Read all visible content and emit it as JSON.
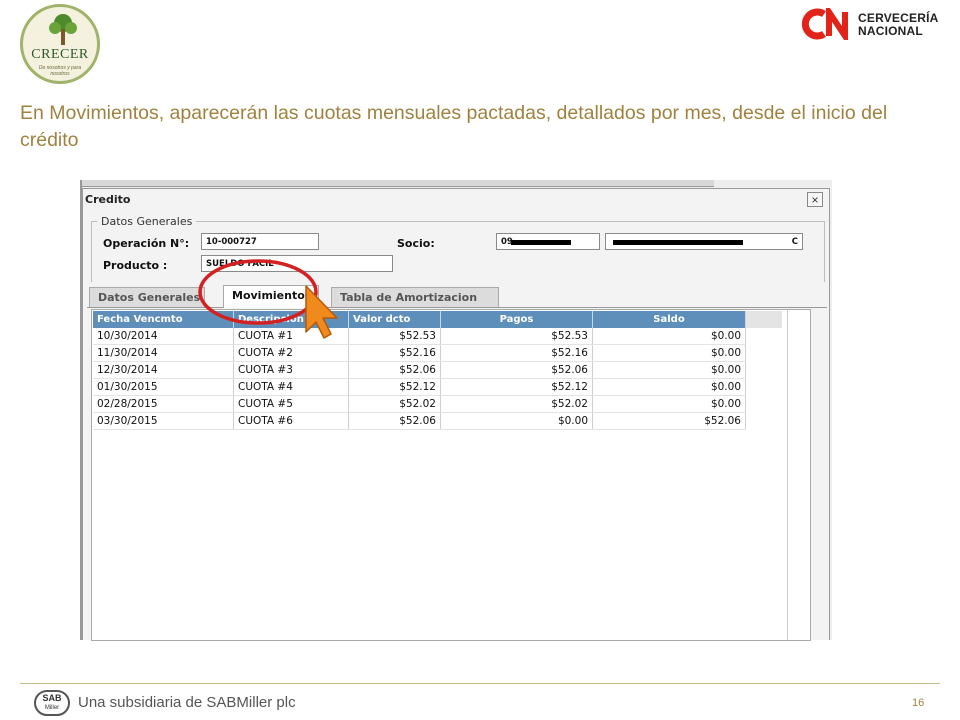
{
  "header": {
    "left_logo": {
      "name": "CRECER",
      "tagline": "De nosotros y para nosotros"
    },
    "right_logo": {
      "line1": "CERVECERÍA",
      "line2": "NACIONAL",
      "brand_color": "#e2231a"
    }
  },
  "slide": {
    "heading": "En Movimientos, aparecerán las cuotas mensuales pactadas, detallados por mes, desde el inicio del crédito",
    "heading_color": "#a0823f"
  },
  "window": {
    "title": "Credito",
    "close_label": "×",
    "general": {
      "legend": "Datos Generales",
      "operacion_label": "Operación N°:",
      "operacion_value": "10-000727",
      "socio_label": "Socio:",
      "socio_id_value": "09",
      "socio_name_value": "C",
      "producto_label": "Producto :",
      "producto_value": "SUELDO FACIL"
    },
    "tabs": [
      {
        "label": "Datos Generales"
      },
      {
        "label": "Movimientos"
      },
      {
        "label": "Tabla de Amortizacion"
      }
    ],
    "grid": {
      "header_color": "#5e8fba",
      "columns": [
        "Fecha Vencmto",
        "Descripcion",
        "Valor dcto",
        "Pagos",
        "Saldo"
      ],
      "rows": [
        [
          "10/30/2014",
          "CUOTA #1",
          "$52.53",
          "$52.53",
          "$0.00"
        ],
        [
          "11/30/2014",
          "CUOTA #2",
          "$52.16",
          "$52.16",
          "$0.00"
        ],
        [
          "12/30/2014",
          "CUOTA #3",
          "$52.06",
          "$52.06",
          "$0.00"
        ],
        [
          "01/30/2015",
          "CUOTA #4",
          "$52.12",
          "$52.12",
          "$0.00"
        ],
        [
          "02/28/2015",
          "CUOTA #5",
          "$52.02",
          "$52.02",
          "$0.00"
        ],
        [
          "03/30/2015",
          "CUOTA #6",
          "$52.06",
          "$0.00",
          "$52.06"
        ]
      ]
    }
  },
  "footer": {
    "logo_text": "SAB",
    "logo_sub": "Miller",
    "text": "Una subsidiaria de SABMiller plc",
    "page_number": "16"
  }
}
